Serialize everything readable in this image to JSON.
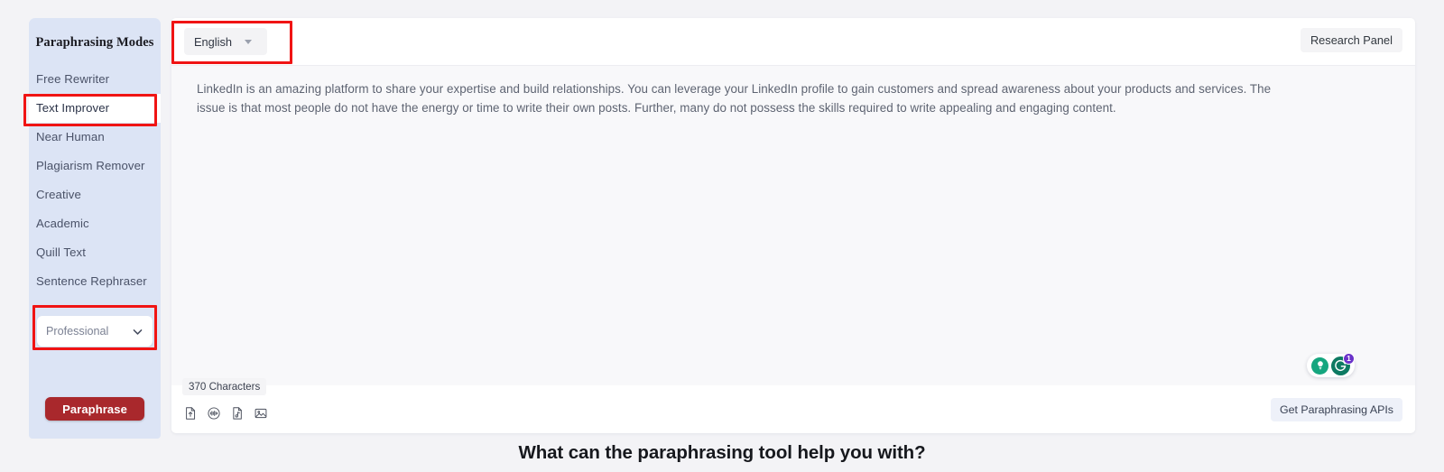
{
  "sidebar": {
    "title": "Paraphrasing Modes",
    "items": [
      {
        "label": "Free Rewriter",
        "active": false
      },
      {
        "label": "Text Improver",
        "active": true
      },
      {
        "label": "Near Human",
        "active": false
      },
      {
        "label": "Plagiarism Remover",
        "active": false
      },
      {
        "label": "Creative",
        "active": false
      },
      {
        "label": "Academic",
        "active": false
      },
      {
        "label": "Quill Text",
        "active": false
      },
      {
        "label": "Sentence Rephraser",
        "active": false
      }
    ],
    "tone_select": {
      "value": "Professional",
      "icon": "chevron-down-icon"
    },
    "paraphrase_button": "Paraphrase"
  },
  "editor": {
    "language_select": {
      "value": "English",
      "icon": "caret-down-icon"
    },
    "research_panel_button": "Research Panel",
    "content": "LinkedIn is an amazing platform to share your expertise and build relationships. You can leverage your LinkedIn profile to gain customers and spread awareness about your products and services. The issue is that most people do not have the energy or time to write their own posts. Further, many do not possess the skills required to write appealing and engaging content.",
    "character_count": "370 Characters",
    "tool_icons": [
      {
        "name": "upload-file-icon",
        "title": "Upload document"
      },
      {
        "name": "audio-waveform-icon",
        "title": "Audio input"
      },
      {
        "name": "music-note-document-icon",
        "title": "Audio file"
      },
      {
        "name": "image-icon",
        "title": "Image upload"
      }
    ],
    "api_button": "Get Paraphrasing APIs",
    "assistant_widget": {
      "bulb_icon": "lightbulb-icon",
      "brand_icon": "grammarly-g-icon",
      "badge_count": "1"
    }
  },
  "bottom": {
    "heading": "What can the paraphrasing tool help you with?"
  },
  "colors": {
    "sidebar_bg": "#dce4f5",
    "accent_red": "#a9282c",
    "annotation_red": "#f01414",
    "page_bg": "#f3f3f6",
    "editor_body_bg": "#f8f8fa",
    "assistant_green": "#0d7a62",
    "badge_purple": "#6a32c9"
  }
}
